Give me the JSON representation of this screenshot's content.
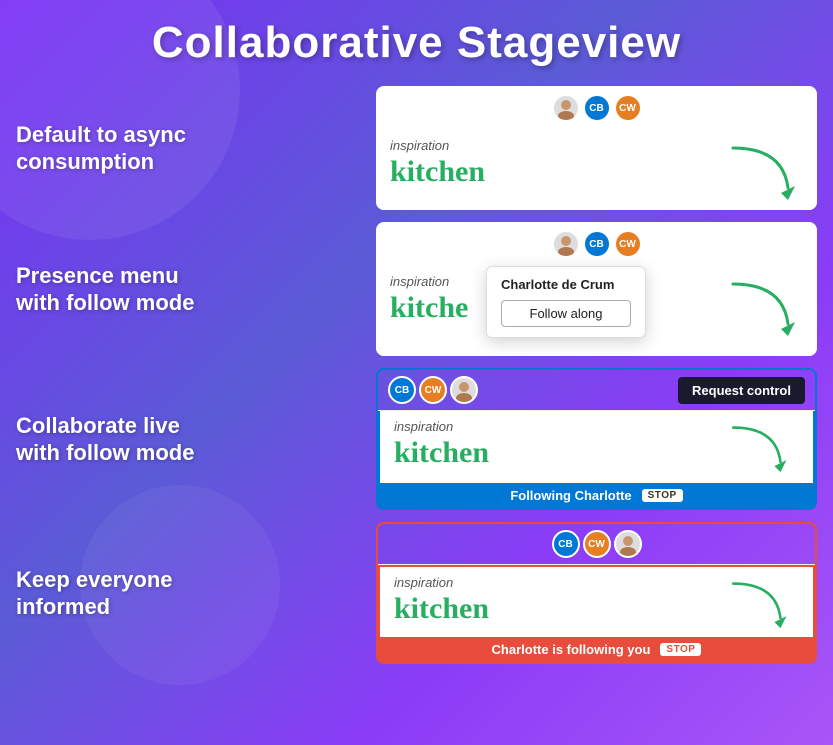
{
  "page": {
    "title": "Collaborative Stageview",
    "background_color": "#7b2ff7"
  },
  "rows": [
    {
      "id": "row1",
      "label": "Default to async\nconsumption",
      "panel": {
        "avatars": [
          {
            "id": "av1",
            "type": "photo",
            "color": "#aaa"
          },
          {
            "id": "av2",
            "initials": "CB",
            "color": "#0078d4"
          },
          {
            "id": "av3",
            "initials": "CW",
            "color": "#e67e22"
          }
        ],
        "inspiration": "inspiration",
        "kitchen": "kitchen"
      }
    },
    {
      "id": "row2",
      "label": "Presence menu\nwith follow mode",
      "panel": {
        "avatars": [
          {
            "id": "av1",
            "type": "photo",
            "color": "#aaa"
          },
          {
            "id": "av2",
            "initials": "CB",
            "color": "#0078d4"
          },
          {
            "id": "av3",
            "initials": "CW",
            "color": "#e67e22"
          }
        ],
        "inspiration": "inspiration",
        "kitchen": "kitche",
        "popup": {
          "name": "Charlotte de Crum",
          "button_label": "Follow along"
        }
      }
    },
    {
      "id": "row3",
      "label": "Collaborate live\nwith follow mode",
      "panel": {
        "avatars": [
          {
            "id": "av1",
            "initials": "CB",
            "color": "#0078d4"
          },
          {
            "id": "av2",
            "initials": "CW",
            "color": "#e67e22"
          },
          {
            "id": "av3",
            "type": "photo",
            "color": "#aaa"
          }
        ],
        "request_control_label": "Request control",
        "inspiration": "inspiration",
        "kitchen": "kitchen",
        "following_label": "Following Charlotte",
        "stop_label": "STOP"
      }
    },
    {
      "id": "row4",
      "label": "Keep everyone\ninformed",
      "panel": {
        "avatars": [
          {
            "id": "av1",
            "initials": "CB",
            "color": "#0078d4"
          },
          {
            "id": "av2",
            "initials": "CW",
            "color": "#e67e22"
          },
          {
            "id": "av3",
            "type": "photo",
            "color": "#aaa"
          }
        ],
        "inspiration": "inspiration",
        "kitchen": "kitchen",
        "following_label": "Charlotte is following you",
        "stop_label": "STOP"
      }
    }
  ]
}
